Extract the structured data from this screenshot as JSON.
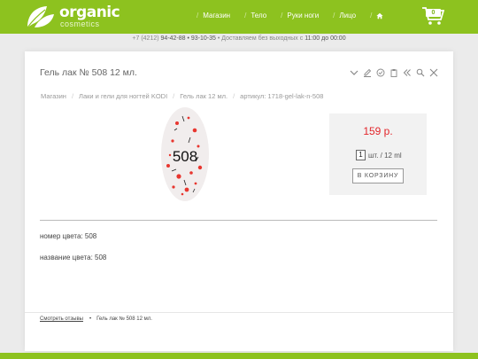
{
  "brand": {
    "name": "organic",
    "tagline": "cosmetics"
  },
  "nav": {
    "items": [
      "Магазин",
      "Тело",
      "Руки ноги",
      "Лицо"
    ]
  },
  "cart": {
    "count": "0"
  },
  "info_strip": {
    "phone_prefix": "+7 (4212)",
    "phones": "94-42-88 • 93-10-35",
    "delivery_prefix": "• Доставляем без выходных с",
    "hours": "11:00 до 00:00"
  },
  "product": {
    "title": "Гель лак № 508 12 мл.",
    "image_label": "508",
    "price": "159 р.",
    "quantity": "1",
    "unit": "шт. / 12 ml",
    "buy_label": "В КОРЗИНУ",
    "color_number": "номер цвета: 508",
    "color_name": "название цвета: 508"
  },
  "breadcrumbs": [
    "Магазин",
    "Лаки и гели для ногтей KODI",
    "Гель лак 12 мл.",
    "артикул: 1718-gel-lak-n-508"
  ],
  "bottom": {
    "reviews_link": "Смотреть отзывы",
    "item": "Гель лак № 508 12 мл."
  },
  "colors": {
    "brand_green": "#8dc21f",
    "price_red": "#e3262b"
  }
}
